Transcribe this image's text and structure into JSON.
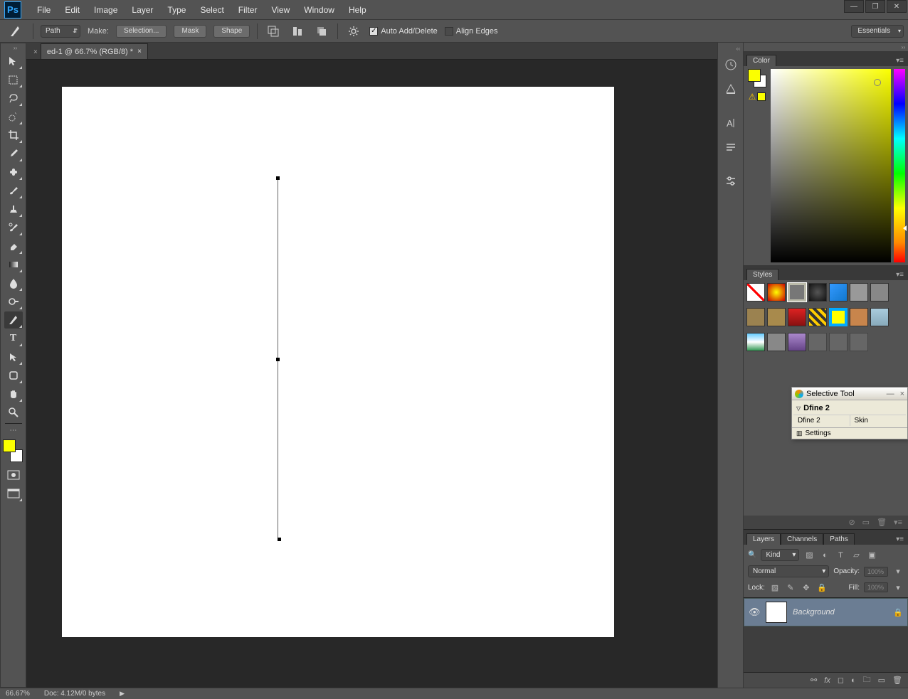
{
  "menubar": {
    "logo": "Ps",
    "items": [
      "File",
      "Edit",
      "Image",
      "Layer",
      "Type",
      "Select",
      "Filter",
      "View",
      "Window",
      "Help"
    ]
  },
  "options_bar": {
    "mode_select": "Path",
    "make_label": "Make:",
    "make_buttons": [
      "Selection...",
      "Mask",
      "Shape"
    ],
    "auto_add_delete": "Auto Add/Delete",
    "align_edges": "Align Edges",
    "workspace": "Essentials"
  },
  "document": {
    "tab_title": "ed-1 @ 66.7% (RGB/8) *"
  },
  "color_panel": {
    "tab": "Color",
    "foreground": "#fbff00",
    "background": "#ffffff"
  },
  "styles_panel": {
    "tab": "Styles"
  },
  "selective_tool": {
    "title": "Selective Tool",
    "section": "Dfine 2",
    "row_left": "Dfine 2",
    "row_right": "Skin",
    "settings": "Settings"
  },
  "layers_panel": {
    "tabs": [
      "Layers",
      "Channels",
      "Paths"
    ],
    "kind": "Kind",
    "blend_mode": "Normal",
    "opacity_label": "Opacity:",
    "opacity_value": "100%",
    "lock_label": "Lock:",
    "fill_label": "Fill:",
    "fill_value": "100%",
    "layer_name": "Background"
  },
  "status_bar": {
    "zoom": "66.67%",
    "doc_info": "Doc: 4.12M/0 bytes"
  }
}
